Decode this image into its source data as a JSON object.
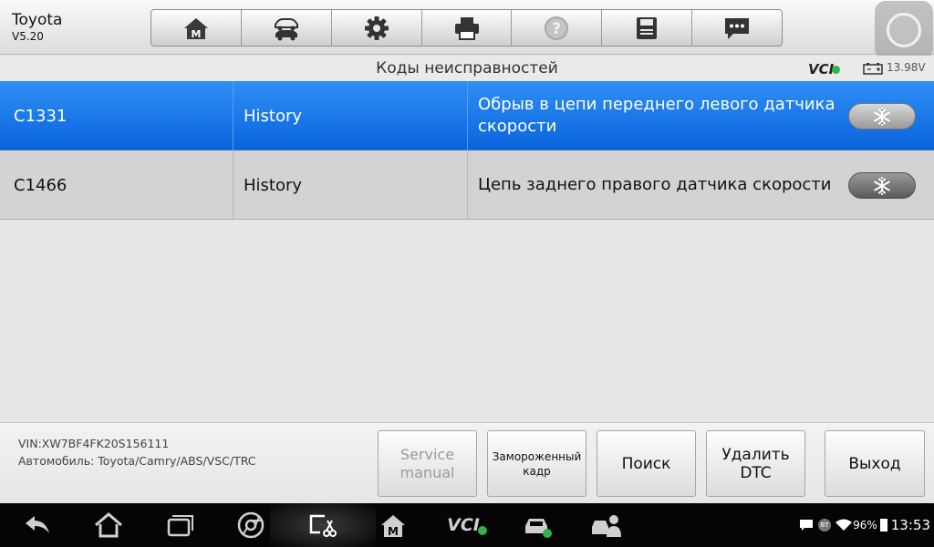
{
  "header": {
    "make": "Toyota",
    "version": "V5.20",
    "toolbar_icons": [
      "home-m-icon",
      "vehicle-swap-icon",
      "gear-icon",
      "printer-icon",
      "help-icon",
      "save-icon",
      "message-icon"
    ]
  },
  "title_bar": {
    "title": "Коды неисправностей",
    "vci_label": "VCI",
    "voltage": "13.98V"
  },
  "dtc_rows": [
    {
      "code": "C1331",
      "status": "History",
      "description": "Обрыв в цепи переднего левого датчика скорости",
      "selected": true
    },
    {
      "code": "C1466",
      "status": "History",
      "description": "Цепь заднего правого датчика скорости",
      "selected": false
    }
  ],
  "footer": {
    "vin": "VIN:XW7BF4FK20S156111",
    "vehicle": "Автомобиль: Toyota/Camry/ABS/VSC/TRC",
    "service_manual_line1": "Service",
    "service_manual_line2": "manual",
    "freeze_frame_line1": "Замороженный",
    "freeze_frame_line2": "кадр",
    "search": "Поиск",
    "delete_line1": "Удалить",
    "delete_line2": "DTC",
    "exit": "Выход"
  },
  "navbar": {
    "vci_label": "VCI",
    "bluetooth": "BT",
    "battery_pct": "96%",
    "clock": "13:53"
  },
  "colors": {
    "selected_row": "#1a76e8",
    "row_bg": "#d3d3d3",
    "vci_ok": "#31b44a"
  }
}
